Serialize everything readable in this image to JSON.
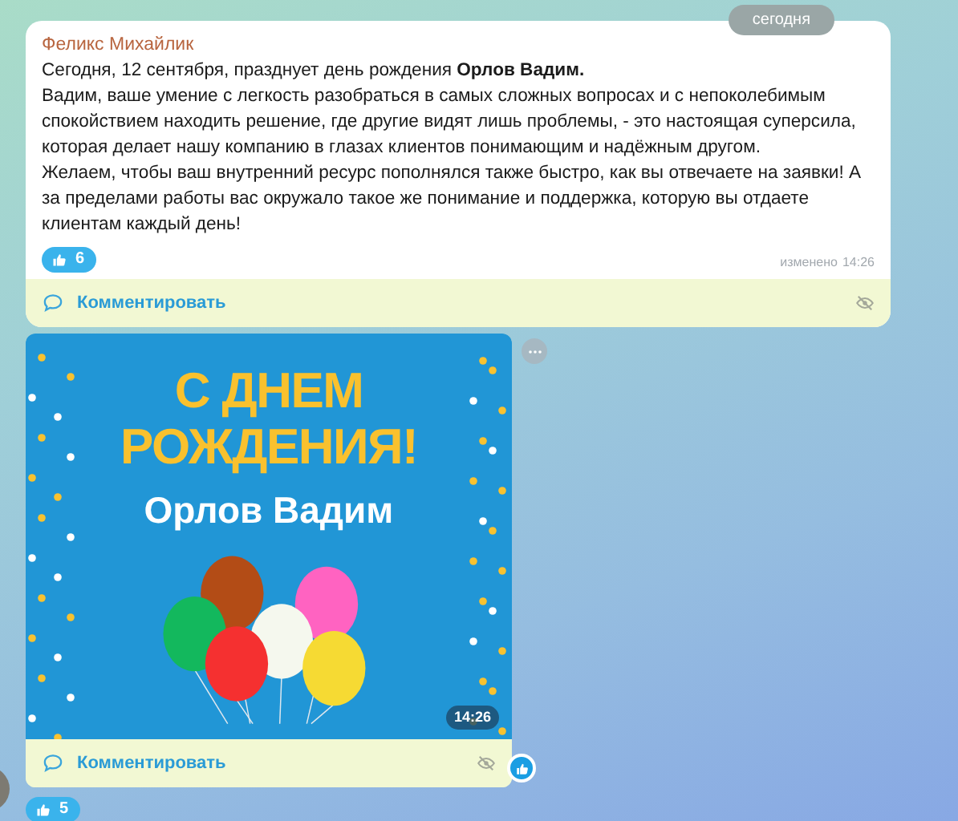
{
  "date_separator": "сегодня",
  "messages": [
    {
      "kind": "text",
      "author": "Феликс Михайлик",
      "paragraphs": [
        "Сегодня, 12 сентября, празднует день рождения **Орлов Вадим.**",
        "Вадим, ваше умение с легкость разобраться в самых сложных вопросах и с непоколебимым спокойствием находить решение, где другие видят лишь проблемы, - это настоящая суперсила, которая делает нашу компанию в глазах клиентов понимающим и надёжным другом.",
        "Желаем, чтобы ваш внутренний ресурс пополнялся также быстро, как вы отвечаете на заявки! А за пределами работы вас окружало такое же понимание и поддержка, которую вы отдаете клиентам каждый день!"
      ],
      "reaction": {
        "count": "6"
      },
      "edited": "изменено",
      "time": "14:26",
      "comment_label": "Комментировать"
    },
    {
      "kind": "image",
      "card": {
        "headline_lines": [
          "С ДНЕМ",
          "РОЖДЕНИЯ!"
        ],
        "name": "Орлов Вадим"
      },
      "time": "14:26",
      "comment_label": "Комментировать",
      "reaction": {
        "count": "5"
      }
    }
  ]
}
